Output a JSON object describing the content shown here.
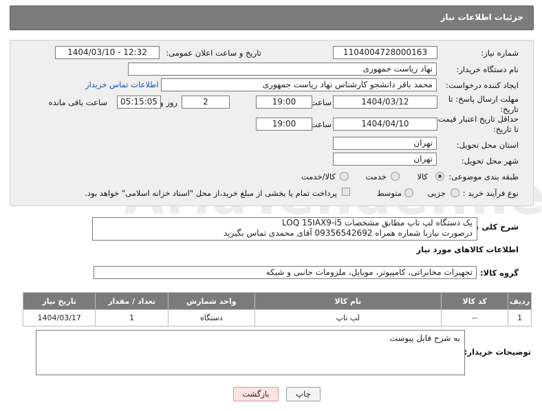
{
  "header": {
    "title": "جزئیات اطلاعات نیاز"
  },
  "form": {
    "need_number_label": "شماره نیاز:",
    "need_number": "1104004728000163",
    "announce_label": "تاریخ و ساعت اعلان عمومی:",
    "announce_value": "1404/03/10 - 12:32",
    "buyer_org_label": "نام دستگاه خریدار:",
    "buyer_org": "نهاد ریاست جمهوری",
    "creator_label": "ایجاد کننده درخواست:",
    "creator": "محمد باقر دانشجو کارشناس نهاد ریاست جمهوری",
    "buyer_contact_link": "اطلاعات تماس خریدار",
    "deadline_label_1": "مهلت ارسال پاسخ: تا",
    "deadline_label_2": "تاریخ:",
    "deadline_date": "1404/03/12",
    "time_label": "ساعت",
    "deadline_time": "19:00",
    "days_value": "2",
    "days_label": "روز و",
    "remaining_time": "05:15:05",
    "remaining_label": "ساعت باقی مانده",
    "price_label_1": "حداقل تاریخ اعتبار قیمت:",
    "price_label_2": "تا تاریخ:",
    "price_date": "1404/04/10",
    "price_time": "19:00",
    "province_label": "استان محل تحویل:",
    "province": "تهران",
    "city_label": "شهر محل تحویل:",
    "city": "تهران",
    "category_label": "طبقه بندی موضوعی:",
    "category_options": [
      "کالا",
      "خدمت",
      "کالا/خدمت"
    ],
    "process_label": "نوع فرآیند خرید :",
    "process_options": [
      "جزیی",
      "متوسط"
    ],
    "payment_note": "پرداخت تمام یا بخشی از مبلغ خرید،از محل \"اسناد خزانه اسلامی\" خواهد بود."
  },
  "summary": {
    "label": "شرح کلی نیاز:",
    "line1": "یک دستگاه  لپ تاپ مطابق مشخصات LOQ 15IAX9-i5",
    "line2": "درصورت نیازبا شماره همراه 09356542692 آقای محمدی تماس بگیرید"
  },
  "goods_section_title": "اطلاعات کالاهای مورد نیاز",
  "goods_group_label": "گروه کالا:",
  "goods_group": "تجهیزات مخابراتی، کامپیوتر، موبایل، ملزومات جانبی و شبکه",
  "table": {
    "headers": [
      "ردیف",
      "کد کالا",
      "نام کالا",
      "واحد شمارش",
      "تعداد / مقدار",
      "تاریخ نیاز"
    ],
    "rows": [
      {
        "row": "1",
        "code": "--",
        "name": "لپ تاپ",
        "unit": "دستگاه",
        "qty": "1",
        "date": "1404/03/17"
      }
    ]
  },
  "buyer_notes_label": "توضیحات خریدار:",
  "buyer_notes": "به شرح فایل پیوست",
  "buttons": {
    "print": "چاپ",
    "back": "بازگشت"
  },
  "watermark": "AriaTender.neT",
  "colors": {
    "header_bg": "#7b7b7b",
    "panel_bg": "#efefef",
    "link": "#1a4fb5",
    "back_button_bg": "#fde3e3"
  }
}
